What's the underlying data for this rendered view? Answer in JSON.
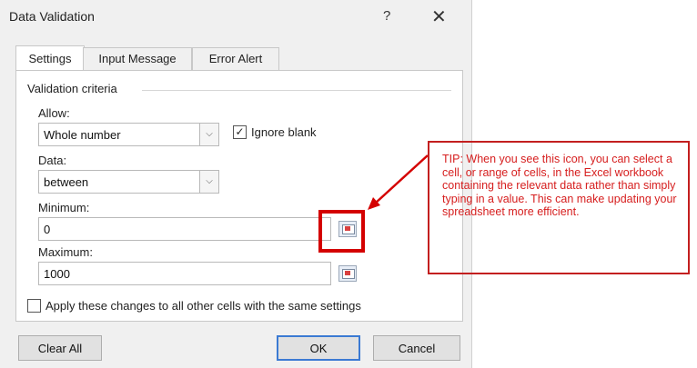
{
  "dialog": {
    "title": "Data Validation",
    "help_label": "?",
    "close_label": "✕"
  },
  "tabs": [
    {
      "label": "Settings",
      "active": true
    },
    {
      "label": "Input Message",
      "active": false
    },
    {
      "label": "Error Alert",
      "active": false
    }
  ],
  "settings": {
    "section_title": "Validation criteria",
    "allow_label": "Allow:",
    "allow_value": "Whole number",
    "ignore_blank_label": "Ignore blank",
    "ignore_blank_checked": true,
    "data_label": "Data:",
    "data_value": "between",
    "minimum_label": "Minimum:",
    "minimum_value": "0",
    "maximum_label": "Maximum:",
    "maximum_value": "1000",
    "apply_all_label": "Apply these changes to all other cells with the same settings",
    "apply_all_checked": false
  },
  "buttons": {
    "clear_all": "Clear All",
    "ok": "OK",
    "cancel": "Cancel"
  },
  "callout": {
    "text": "TIP: When you see this icon, you can select a cell, or range of cells, in the Excel workbook containing the relevant data rather than simply typing in a value.  This can make updating your spreadsheet more efficient.",
    "color": "#d61e1e"
  },
  "icons": {
    "combo_arrow": "chevron-down-icon",
    "range_selector": "range-selector-icon",
    "checkbox_check": "✓"
  }
}
